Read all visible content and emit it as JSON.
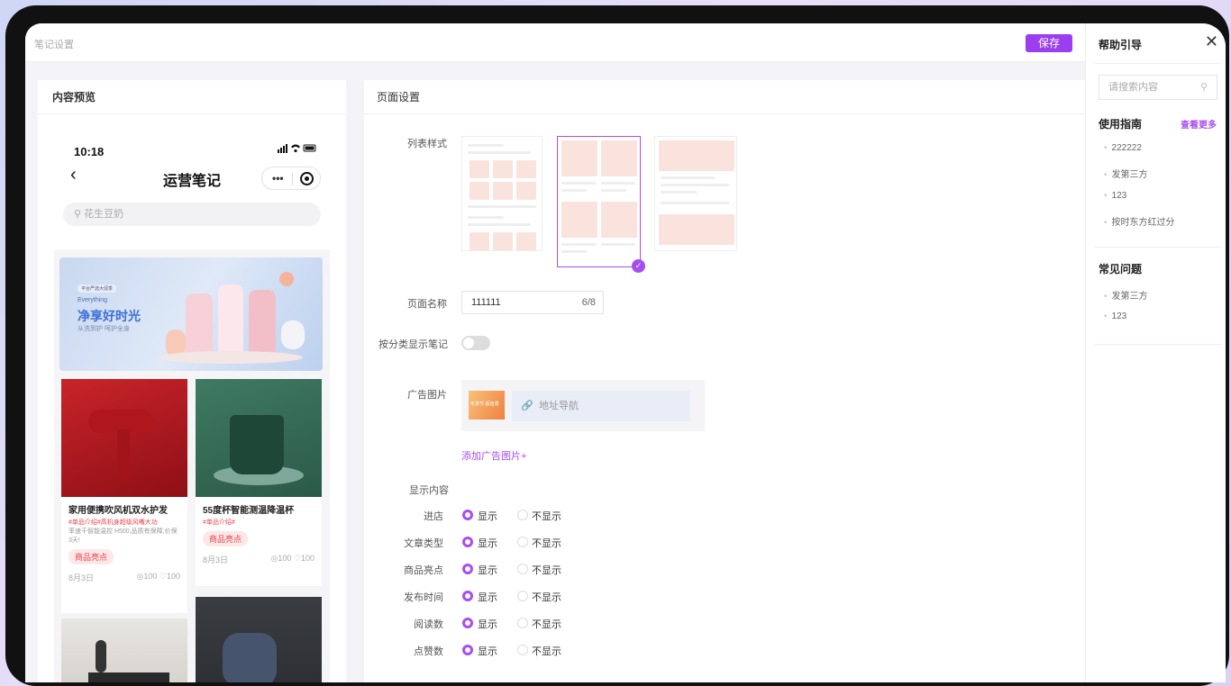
{
  "topbar": {
    "title": "笔记设置",
    "save_label": "保存"
  },
  "preview": {
    "heading": "内容预览",
    "phone": {
      "time": "10:18",
      "status_icons": "signal wifi battery",
      "nav_title": "运营笔记",
      "search_placeholder": "花生豆奶",
      "banner": {
        "tag": "平台严选大促季",
        "en": "Everything",
        "headline": "净享好时光",
        "sub": "从洗到护 呵护全身"
      },
      "cards": [
        {
          "title": "家用便携吹风机双水护发",
          "tags": "#单品介绍#高机身超级风嘴大功",
          "desc": "率速干智能温控 H500,品质有保障,价保3天!",
          "badge": "商品亮点",
          "date": "8月3日",
          "stats": "◎100 ♡100"
        },
        {
          "title": "55度杯智能测温降温杯",
          "tags": "#单品介绍#",
          "desc": "",
          "badge": "商品亮点",
          "date": "8月3日",
          "stats": "◎100 ♡100"
        }
      ]
    }
  },
  "settings": {
    "heading": "页面设置",
    "list_style_label": "列表样式",
    "list_styles": [
      "single-column",
      "double-column",
      "large-card"
    ],
    "selected_style": "double-column",
    "page_name_label": "页面名称",
    "page_name_value": "111111",
    "page_name_count": "6/8",
    "category_label": "按分类显示笔记",
    "ad_label": "广告图片",
    "ad_thumb_text": "年货节·超值惠",
    "ad_link_placeholder": "地址导航",
    "add_ad_label": "添加广告图片+",
    "display_label": "显示内容",
    "show_label": "显示",
    "hide_label": "不显示",
    "display_rows": [
      {
        "label": "进店",
        "value": "显示"
      },
      {
        "label": "文章类型",
        "value": "显示"
      },
      {
        "label": "商品亮点",
        "value": "显示"
      },
      {
        "label": "发布时间",
        "value": "显示"
      },
      {
        "label": "阅读数",
        "value": "显示"
      },
      {
        "label": "点赞数",
        "value": "显示"
      }
    ]
  },
  "help": {
    "title": "帮助引导",
    "search_placeholder": "请搜索内容",
    "guide_title": "使用指南",
    "guide_more": "查看更多",
    "guide_items": [
      "222222",
      "发第三方",
      "123",
      "按时东方红过分"
    ],
    "faq_title": "常见问题",
    "faq_items": [
      "发第三方",
      "123"
    ]
  },
  "colors": {
    "accent": "#a74ef0",
    "tag_red": "#e9434c",
    "brand_btn": "#9b3ef0"
  }
}
